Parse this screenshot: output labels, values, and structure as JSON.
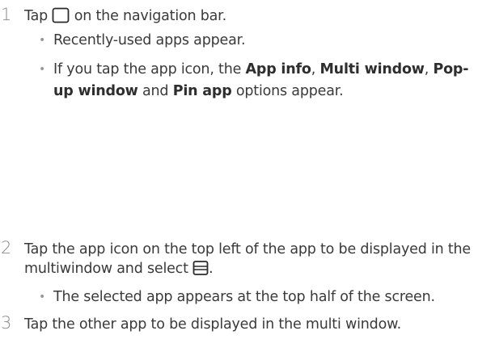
{
  "step1": {
    "number": "1",
    "text_before_icon": "Tap ",
    "icon": "overview-square-icon",
    "text_after_icon": " on the navigation bar.",
    "bullets": {
      "b1": "Recently-used apps appear.",
      "b2": {
        "t1": "If you tap the app icon, the ",
        "app_info": "App info",
        "t2": ", ",
        "multi_window": "Multi window",
        "t3": ", ",
        "popup_window": "Pop-up window",
        "t4": " and ",
        "pin_app": "Pin app",
        "t5": " options appear."
      }
    }
  },
  "step2": {
    "number": "2",
    "line1": "Tap the app icon on the top left of the app to be displayed in the",
    "line2_before_icon": "multiwindow and select ",
    "icon": "split-screen-icon",
    "line2_after_icon": ".",
    "bullets": {
      "b1": "The selected app appears at the top half of the screen."
    }
  },
  "step3": {
    "number": "3",
    "text": "Tap the other app to be displayed in the multi window."
  }
}
